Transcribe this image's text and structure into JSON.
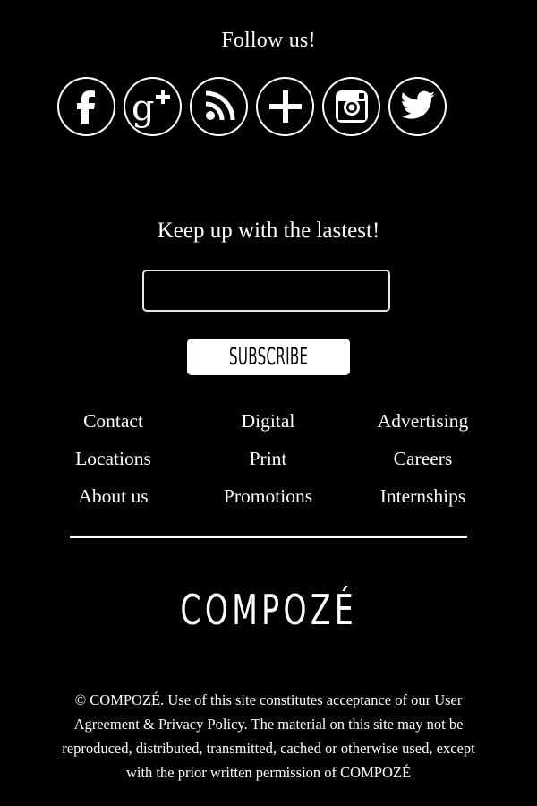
{
  "follow": {
    "title": "Follow us!"
  },
  "social": {
    "items": [
      {
        "icon": "facebook-icon"
      },
      {
        "icon": "google-plus-icon"
      },
      {
        "icon": "rss-icon"
      },
      {
        "icon": "plus-icon"
      },
      {
        "icon": "instagram-icon"
      },
      {
        "icon": "twitter-icon"
      }
    ]
  },
  "newsletter": {
    "title": "Keep up with the lastest!",
    "input_value": "",
    "input_placeholder": "",
    "subscribe_label": "SUBSCRIBE"
  },
  "links": [
    "Contact",
    "Digital",
    "Advertising",
    "Locations",
    "Print",
    "Careers",
    "About us",
    "Promotions",
    "Internships"
  ],
  "brand": {
    "name": "COMPOZÉ"
  },
  "footer": {
    "copyright": "© COMPOZÉ. Use of this site constitutes acceptance of our User Agreement & Privacy Policy. The material on this site may not be reproduced, distributed, transmitted, cached or otherwise used, except with the prior written permission of COMPOZÉ"
  },
  "colors": {
    "background": "#000000",
    "foreground": "#ffffff"
  }
}
